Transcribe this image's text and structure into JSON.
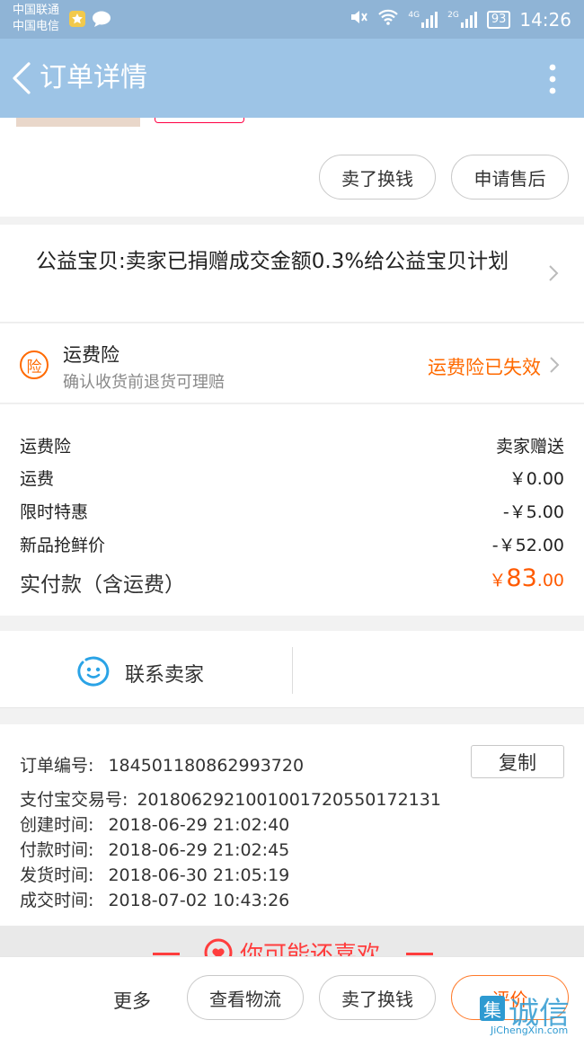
{
  "status_bar": {
    "carrier_1": "中国联通",
    "carrier_2": "中国电信",
    "network_1": "4G",
    "network_2": "2G",
    "battery": "93",
    "time": "14:26"
  },
  "app_bar": {
    "title": "订单详情"
  },
  "order_actions": {
    "sell_label": "卖了换钱",
    "after_sale_label": "申请售后"
  },
  "charity": {
    "text": "公益宝贝:卖家已捐赠成交金额0.3%给公益宝贝计划"
  },
  "insurance": {
    "icon_glyph": "险",
    "title": "运费险",
    "subtitle": "确认收货前退货可理赔",
    "status": "运费险已失效"
  },
  "fees": {
    "rows": [
      {
        "label": "运费险",
        "value": "卖家赠送"
      },
      {
        "label": "运费",
        "value": "￥0.00"
      },
      {
        "label": "限时特惠",
        "value": "-￥5.00"
      },
      {
        "label": "新品抢鲜价",
        "value": "-￥52.00"
      }
    ],
    "total_label": "实付款（含运费）",
    "total_currency": "￥",
    "total_int": "83",
    "total_dec": ".00"
  },
  "contact": {
    "label": "联系卖家"
  },
  "order_info": {
    "copy_label": "复制",
    "rows": [
      {
        "key": "订单编号:",
        "value": "184501180862993720"
      },
      {
        "key": "支付宝交易号:",
        "value": "2018062921001001720550172131"
      },
      {
        "key": "创建时间:",
        "value": "2018-06-29 21:02:40"
      },
      {
        "key": "付款时间:",
        "value": "2018-06-29 21:02:45"
      },
      {
        "key": "发货时间:",
        "value": "2018-06-30 21:05:19"
      },
      {
        "key": "成交时间:",
        "value": "2018-07-02 10:43:26"
      }
    ]
  },
  "recommend": {
    "title": "你可能还喜欢"
  },
  "bottom_bar": {
    "more_label": "更多",
    "logistics_label": "查看物流",
    "sell_label": "卖了换钱",
    "review_label": "评价"
  },
  "watermark": {
    "glyph": "集",
    "text": "诚信",
    "sub": "JiChengXin.com"
  },
  "colors": {
    "status_bar": "#8fb4d6",
    "app_bar": "#9dc4e6",
    "accent": "#ff5a00",
    "contact_icon": "#2aa3e6"
  }
}
